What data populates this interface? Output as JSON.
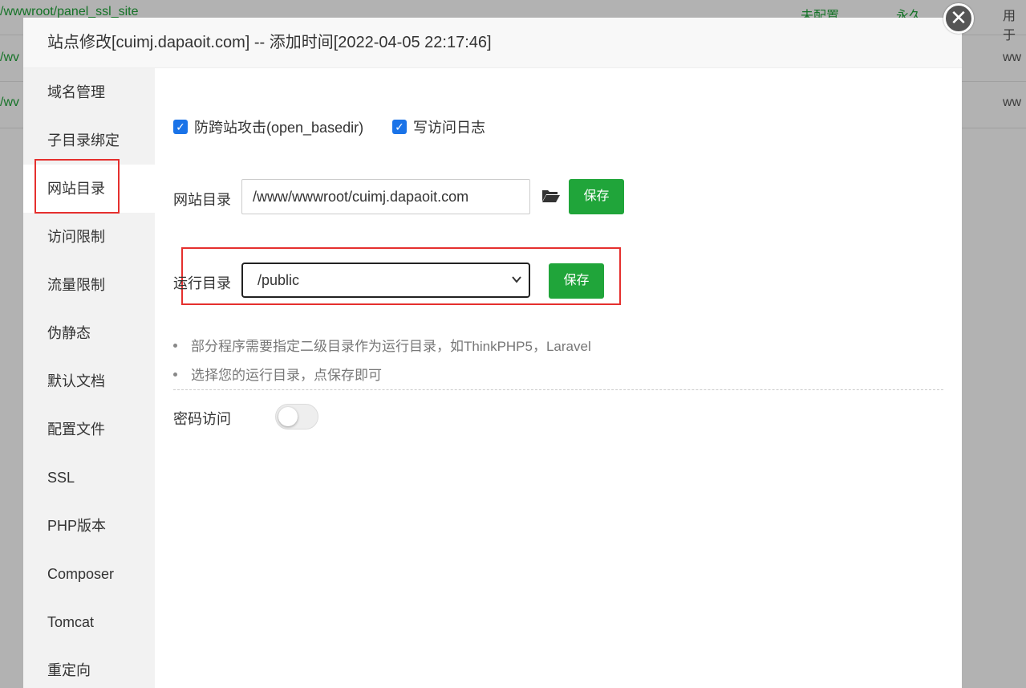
{
  "background_rows": [
    {
      "path": "/wwwroot/panel_ssl_site",
      "status": "未配置",
      "expire": "永久",
      "note": "用于"
    },
    {
      "path": "/wv",
      "note": "ww"
    },
    {
      "path": "/wv",
      "note": "ww"
    }
  ],
  "dialog": {
    "title": "站点修改[cuimj.dapaoit.com] -- 添加时间[2022-04-05 22:17:46]",
    "close_symbol": "✕"
  },
  "sidebar": {
    "items": [
      {
        "label": "域名管理"
      },
      {
        "label": "子目录绑定"
      },
      {
        "label": "网站目录",
        "active": true
      },
      {
        "label": "访问限制"
      },
      {
        "label": "流量限制"
      },
      {
        "label": "伪静态"
      },
      {
        "label": "默认文档"
      },
      {
        "label": "配置文件"
      },
      {
        "label": "SSL"
      },
      {
        "label": "PHP版本"
      },
      {
        "label": "Composer"
      },
      {
        "label": "Tomcat"
      },
      {
        "label": "重定向"
      }
    ]
  },
  "options": {
    "anti_xss": {
      "label": "防跨站攻击(open_basedir)",
      "checked": true
    },
    "access_log": {
      "label": "写访问日志",
      "checked": true
    }
  },
  "site_dir": {
    "label": "网站目录",
    "value": "/www/wwwroot/cuimj.dapaoit.com",
    "save_label": "保存",
    "icon": "folder-open-icon"
  },
  "run_dir": {
    "label": "运行目录",
    "selected": "/public",
    "save_label": "保存"
  },
  "tips": [
    "部分程序需要指定二级目录作为运行目录，如ThinkPHP5，Laravel",
    "选择您的运行目录，点保存即可"
  ],
  "password_access": {
    "label": "密码访问",
    "enabled": false
  },
  "colors": {
    "primary_green": "#20a53a",
    "highlight_red": "#e5302e",
    "checkbox_blue": "#1a73e8"
  }
}
